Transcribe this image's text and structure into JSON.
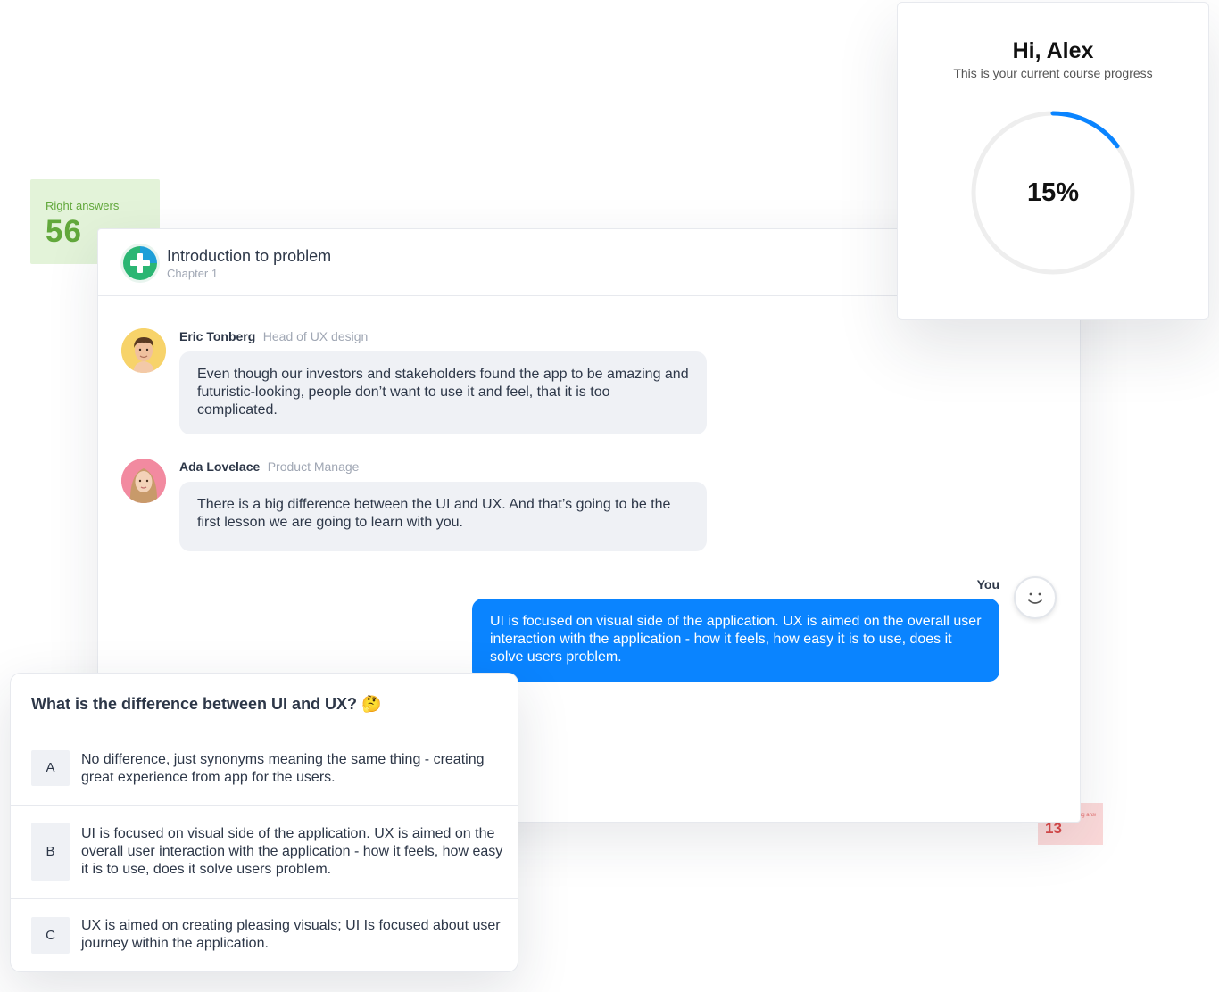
{
  "right_answers": {
    "label": "Right answers",
    "count": "56"
  },
  "wrong_answers": {
    "label": "Wrong answers",
    "count": "13"
  },
  "chat": {
    "title": "Introduction to problem",
    "subtitle": "Chapter 1",
    "messages": [
      {
        "name": "Eric Tonberg",
        "role": "Head of UX design",
        "text": "Even though our investors and stakeholders found the app to be amazing and futuristic-looking, people don’t want to use it and feel, that it is too complicated."
      },
      {
        "name": "Ada Lovelace",
        "role": "Product Manage",
        "text": "There is a big difference between the UI and UX. And that’s going to be the first lesson we are going to learn with you."
      }
    ],
    "you": {
      "label": "You",
      "text": "UI is focused on visual side of the application. UX is aimed on the overall user interaction with the application - how it feels, how easy it is to use, does it solve users problem."
    }
  },
  "progress": {
    "greeting": "Hi, Alex",
    "subtitle": "This is your current course progress",
    "percent_label": "15%",
    "fraction": 0.15,
    "colors": {
      "ring": "#0a84ff",
      "track": "#eeeeee"
    }
  },
  "quiz": {
    "question": "What is the difference between UI and UX? 🤔",
    "options": [
      {
        "letter": "A",
        "text": "No difference, just synonyms meaning the same thing - creating great experience from app for the users."
      },
      {
        "letter": "B",
        "text": "UI is focused on visual side of the application. UX is aimed on the overall user interaction with the application - how it feels, how easy it is to use, does it solve users problem."
      },
      {
        "letter": "C",
        "text": "UX is aimed on creating pleasing visuals; UI Is focused about user journey within the application."
      }
    ]
  },
  "icons": {
    "chapter": "plus-circle-icon",
    "you_avatar": "smiley-face-icon"
  },
  "colors": {
    "accent_blue": "#0a84ff",
    "right_green": "#62a83c",
    "wrong_red": "#d94848"
  }
}
